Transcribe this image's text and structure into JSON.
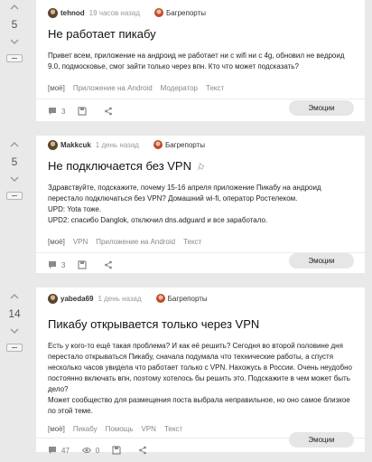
{
  "posts": [
    {
      "rating": "5",
      "author": "tehnod",
      "time": "19 часов назад",
      "community": "Багрепорты",
      "title": "Не работает пикабу",
      "body": [
        "Привет всем, приложение на андроид не работает ни с wifi ни с 4g, обновил не ведроид 9.0, подмосковье, смог зайти только через впн. Кто что может подсказать?"
      ],
      "tags": [
        "[моё]",
        "Приложение на Android",
        "Модератор",
        "Текст"
      ],
      "comments": "3",
      "emotions_label": "Эмоции"
    },
    {
      "rating": "5",
      "author": "Makkcuk",
      "time": "1 день назад",
      "community": "Багрепорты",
      "title": "Не подключается без VPN",
      "body": [
        "Здравствуйте, подскажите, почему 15-16 апреля приложение Пикабу на андроид перестало подключаться без VPN? Домашний wi-fi, оператор Ростелеком.",
        "UPD: Yota тоже.",
        "UPD2: спасибо Danglok, отключил dns.adguard и все заработало."
      ],
      "tags": [
        "[моё]",
        "VPN",
        "Приложение на Android",
        "Текст"
      ],
      "comments": "3",
      "emotions_label": "Эмоции"
    },
    {
      "rating": "14",
      "author": "yabeda69",
      "time": "1 день назад",
      "community": "Багрепорты",
      "title": "Пикабу открывается только через VPN",
      "body": [
        "Есть у кого-то ещё такая проблема? И как её решить? Сегодня во второй половине дня перестало открываться Пикабу, сначала подумала что технические работы, а спустя несколько часов увидела что работает только с VPN. Нахожусь в России. Очень неудобно постоянно включать впн, поэтому хотелось бы решить это. Подскажите в чем может быть дело?",
        "Может сообщество для размещения поста выбрала неправильное, но оно самое близкое по этой теме."
      ],
      "tags": [
        "[моё]",
        "Пикабу",
        "Помощь",
        "VPN",
        "Текст"
      ],
      "comments": "47",
      "views": "0",
      "emotions_label": "Эмоции"
    }
  ]
}
